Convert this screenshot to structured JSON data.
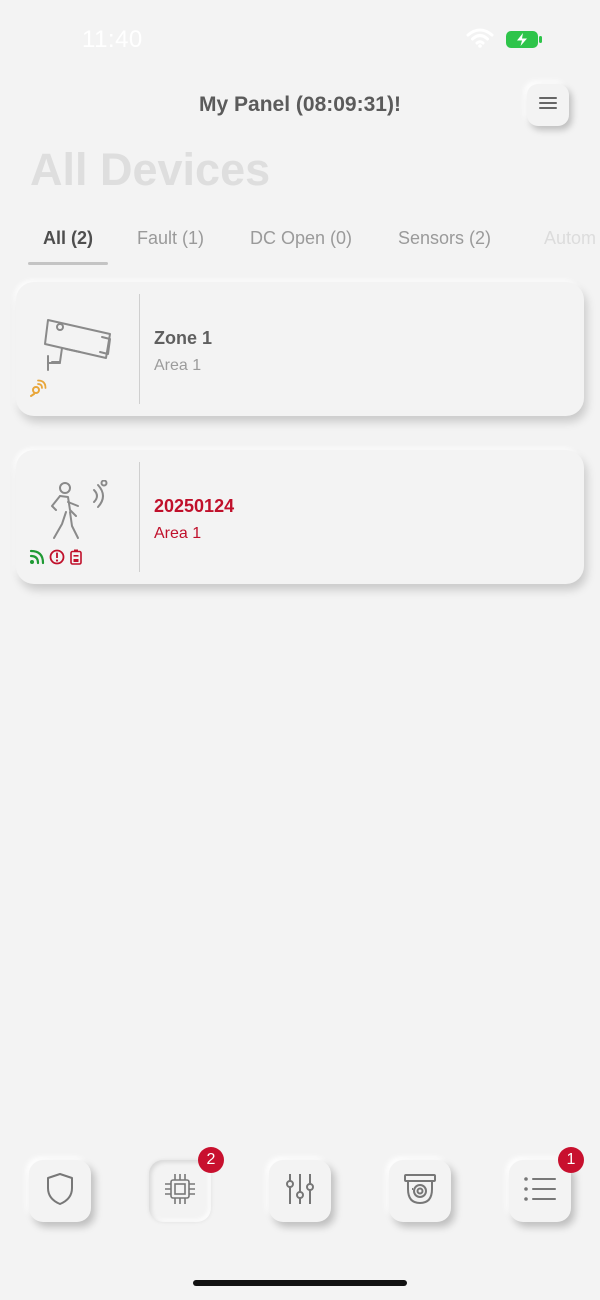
{
  "status_bar": {
    "time": "11:40"
  },
  "header": {
    "title": "My Panel (08:09:31)!",
    "menu_icon": "hamburger-icon"
  },
  "page": {
    "title": "All Devices"
  },
  "tabs": [
    {
      "label": "All (2)",
      "active": true
    },
    {
      "label": "Fault (1)",
      "active": false
    },
    {
      "label": "DC Open (0)",
      "active": false
    },
    {
      "label": "Sensors (2)",
      "active": false
    },
    {
      "label": "Autom",
      "active": false
    }
  ],
  "devices": [
    {
      "name": "Zone 1",
      "area": "Area 1",
      "icon": "camera-icon",
      "status_icons": [
        "rf-link-icon"
      ],
      "alert": false
    },
    {
      "name": "20250124",
      "area": "Area 1",
      "icon": "motion-sensor-icon",
      "status_icons": [
        "signal-icon",
        "fault-icon",
        "battery-low-icon"
      ],
      "alert": true
    }
  ],
  "bottom_nav": [
    {
      "name": "security",
      "icon": "shield-icon",
      "badge": ""
    },
    {
      "name": "devices",
      "icon": "chip-icon",
      "badge": "2"
    },
    {
      "name": "controls",
      "icon": "sliders-icon",
      "badge": ""
    },
    {
      "name": "cameras",
      "icon": "dome-camera-icon",
      "badge": ""
    },
    {
      "name": "events",
      "icon": "list-icon",
      "badge": "1"
    }
  ],
  "colors": {
    "background": "#f3f3f3",
    "alert": "#c0102b",
    "badge": "#c8102e",
    "signal_green": "#1f9a34",
    "battery_green": "#2ec44a",
    "rf_orange": "#e8a63a"
  }
}
